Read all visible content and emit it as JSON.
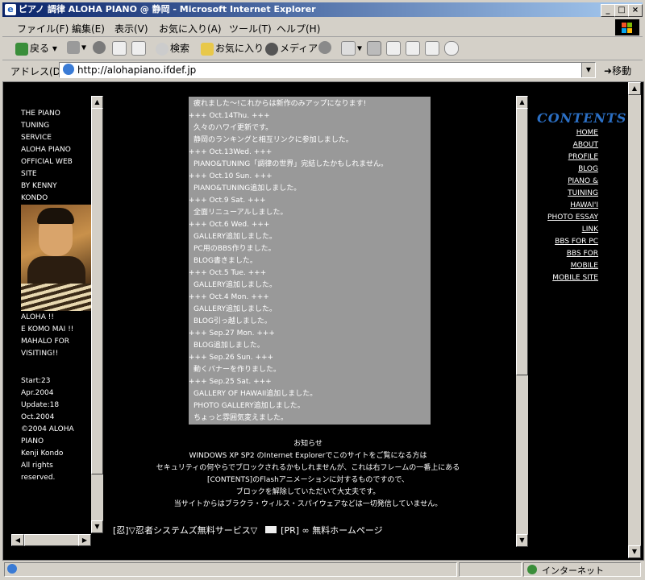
{
  "window": {
    "title": "ピアノ 調律 ALOHA PIANO @ 静岡 - Microsoft Internet Explorer"
  },
  "menu": [
    "ファイル(F)",
    "編集(E)",
    "表示(V)",
    "お気に入り(A)",
    "ツール(T)",
    "ヘルプ(H)"
  ],
  "toolbar": {
    "back": "戻る",
    "search": "検索",
    "favorites": "お気に入り",
    "media": "メディア"
  },
  "address": {
    "label": "アドレス(D)",
    "url": "http://alohapiano.ifdef.jp",
    "go": "移動"
  },
  "left": {
    "lines": [
      "THE PIANO",
      "TUNING",
      "SERVICE",
      "ALOHA PIANO",
      "OFFICIAL WEB",
      "SITE",
      "BY KENNY",
      "KONDO"
    ],
    "greeting": [
      "ALOHA !!",
      "E KOMO MAI !!",
      "MAHALO FOR",
      "VISITING!!"
    ],
    "meta": [
      "Start:23",
      "Apr.2004",
      "Update:18",
      "Oct.2004",
      "©2004 ALOHA",
      "PIANO",
      "Kenji Kondo",
      "All rights",
      "reserved."
    ]
  },
  "news": [
    "疲れました〜!これからは新作のみアップになります!",
    "+++ Oct.14Thu. +++",
    "  久々のハワイ更新です。",
    "  静岡のランキングと相互リンクに参加しました。",
    "+++ Oct.13Wed. +++",
    "  PIANO&TUNING「調律の世界」完結したかもしれません。",
    "+++ Oct.10 Sun. +++",
    "  PIANO&TUNING追加しました。",
    "+++ Oct.9 Sat. +++",
    "  全面リニューアルしました。",
    "+++ Oct.6 Wed. +++",
    "  GALLERY追加しました。",
    "  PC用のBBS作りました。",
    "  BLOG書きました。",
    "+++ Oct.5 Tue. +++",
    "  GALLERY追加しました。",
    "+++ Oct.4 Mon. +++",
    "  GALLERY追加しました。",
    "  BLOG引っ越しました。",
    "+++ Sep.27 Mon. +++",
    "  BLOG追加しました。",
    "+++ Sep.26 Sun. +++",
    "  動くバナーを作りました。",
    "+++ Sep.25 Sat. +++",
    "  GALLERY OF HAWAII追加しました。",
    "  PHOTO GALLERY追加しました。",
    "  ちょっと雰囲気変えました。"
  ],
  "notice": [
    "お知らせ",
    "WINDOWS XP SP2 のInternet Explorerでこのサイトをご覧になる方は",
    "セキュリティの何やらでブロックされるかもしれませんが、これは右フレームの一番上にある",
    "[CONTENTS]のFlashアニメーションに対するものですので、",
    "ブロックを解除していただいて大丈夫です。",
    "当サイトからはブラクラ・ウィルス・スパイウェアなどは一切発信していません。"
  ],
  "footer": {
    "left": "[忍]▽忍者システムズ無料サービス▽",
    "right": "[PR] ∞ 無料ホームページ"
  },
  "contents": {
    "logo": "CONTENTS",
    "items": [
      "HOME",
      "ABOUT",
      "PROFILE",
      "BLOG",
      "PIANO &",
      "TUINING",
      "HAWAI'I",
      "PHOTO ESSAY",
      "LINK",
      "BBS FOR PC",
      "BBS FOR",
      "MOBILE",
      "MOBILE SITE"
    ]
  },
  "status": {
    "zone": "インターネット"
  }
}
